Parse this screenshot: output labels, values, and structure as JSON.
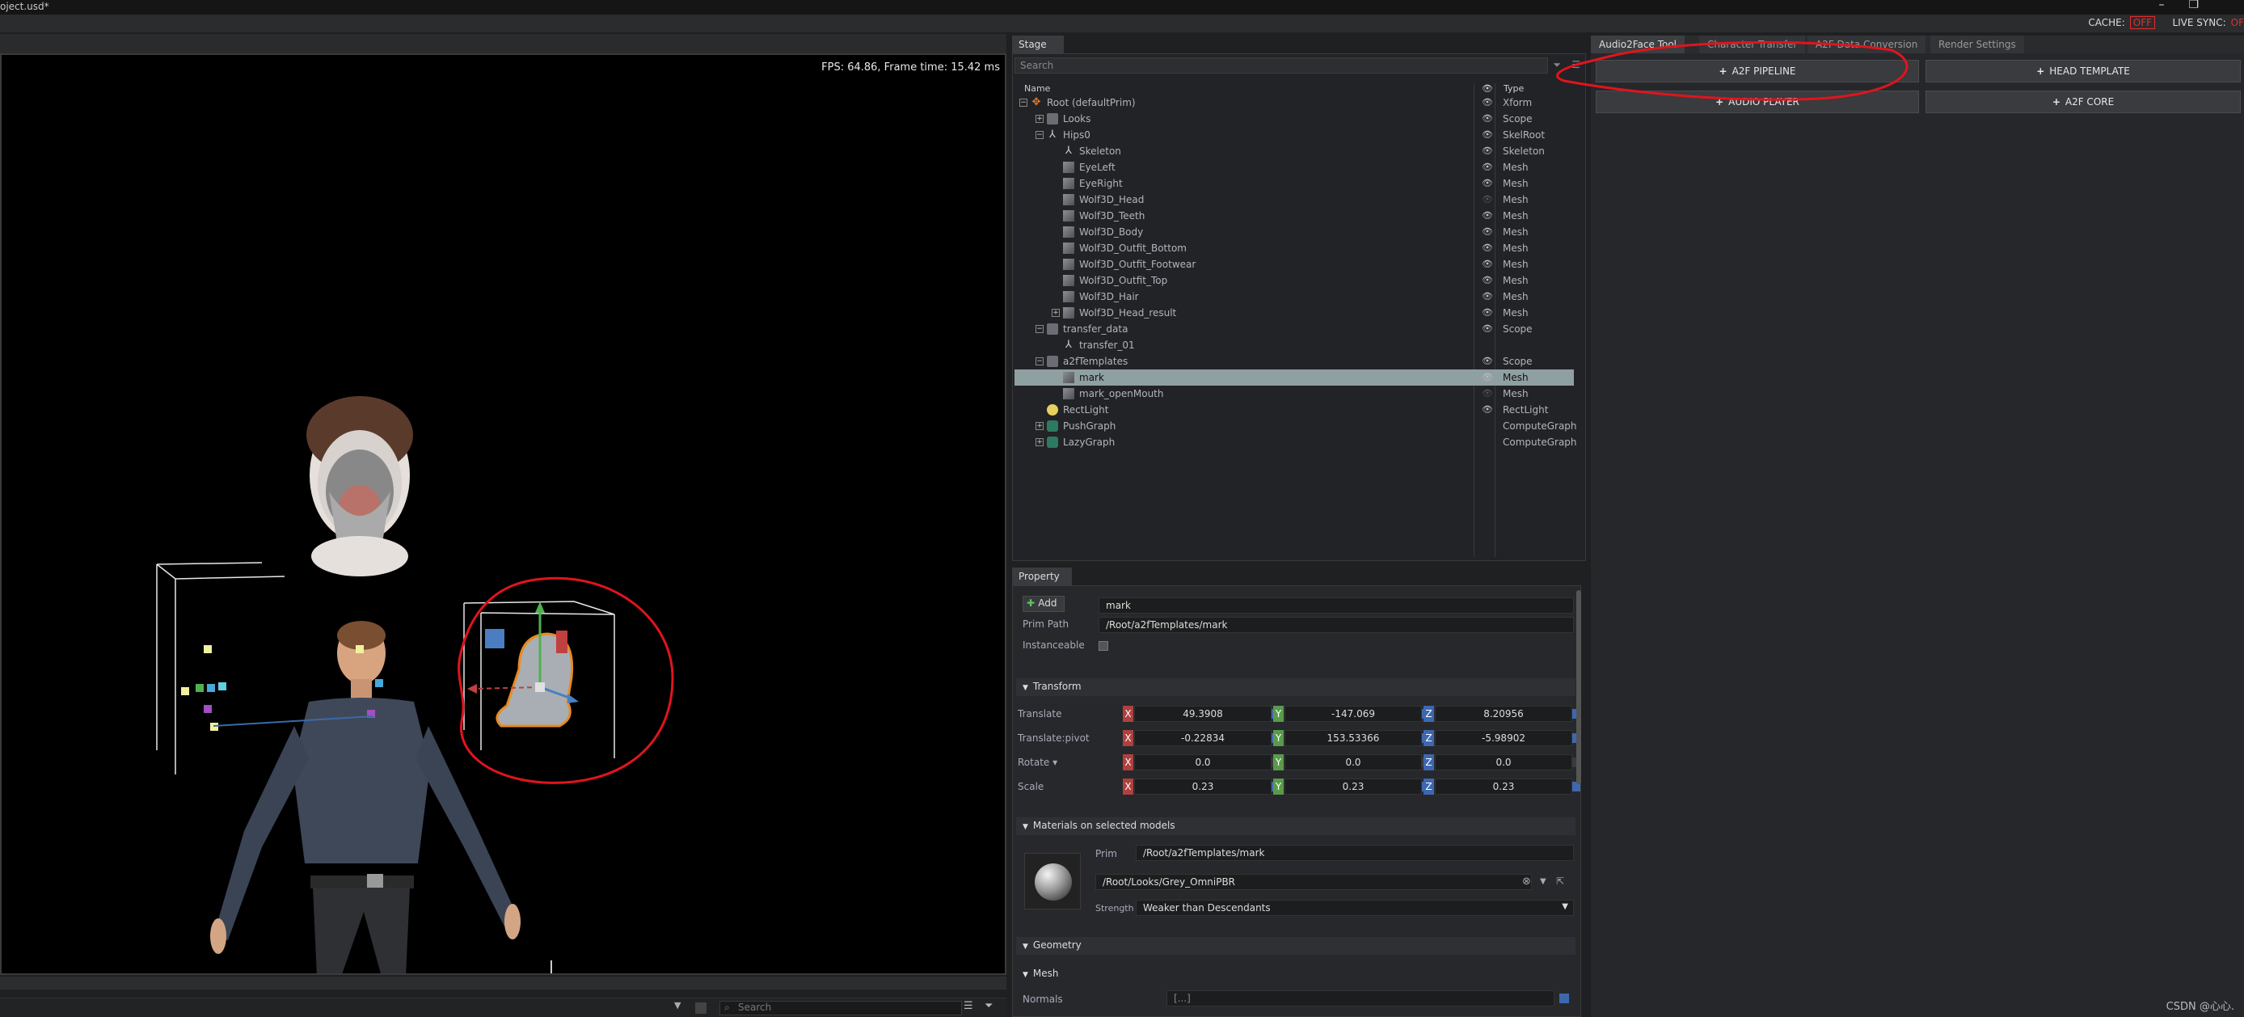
{
  "window": {
    "title": "oject.usd*",
    "cache_label": "CACHE:",
    "cache_state": "OFF",
    "live_sync_label": "LIVE SYNC:",
    "live_sync_state": "OF"
  },
  "viewport": {
    "fps_text": "FPS: 64.86, Frame time: 15.42 ms",
    "search_placeholder": "Search"
  },
  "stage": {
    "tab_label": "Stage",
    "search_placeholder": "Search",
    "col_name": "Name",
    "col_type": "Type",
    "rows": [
      {
        "label": "Root (defaultPrim)",
        "type": "Xform",
        "depth": 0,
        "exp": "−",
        "icon": "xform",
        "eye": true
      },
      {
        "label": "Looks",
        "type": "Scope",
        "depth": 1,
        "exp": "+",
        "icon": "folder",
        "eye": true
      },
      {
        "label": "Hips0",
        "type": "SkelRoot",
        "depth": 1,
        "exp": "−",
        "icon": "skel",
        "eye": true
      },
      {
        "label": "Skeleton",
        "type": "Skeleton",
        "depth": 2,
        "exp": "",
        "icon": "skel",
        "eye": true
      },
      {
        "label": "EyeLeft",
        "type": "Mesh",
        "depth": 2,
        "exp": "",
        "icon": "mesh",
        "eye": true
      },
      {
        "label": "EyeRight",
        "type": "Mesh",
        "depth": 2,
        "exp": "",
        "icon": "mesh",
        "eye": true
      },
      {
        "label": "Wolf3D_Head",
        "type": "Mesh",
        "depth": 2,
        "exp": "",
        "icon": "mesh",
        "eye": false
      },
      {
        "label": "Wolf3D_Teeth",
        "type": "Mesh",
        "depth": 2,
        "exp": "",
        "icon": "mesh",
        "eye": true
      },
      {
        "label": "Wolf3D_Body",
        "type": "Mesh",
        "depth": 2,
        "exp": "",
        "icon": "mesh",
        "eye": true
      },
      {
        "label": "Wolf3D_Outfit_Bottom",
        "type": "Mesh",
        "depth": 2,
        "exp": "",
        "icon": "mesh",
        "eye": true
      },
      {
        "label": "Wolf3D_Outfit_Footwear",
        "type": "Mesh",
        "depth": 2,
        "exp": "",
        "icon": "mesh",
        "eye": true
      },
      {
        "label": "Wolf3D_Outfit_Top",
        "type": "Mesh",
        "depth": 2,
        "exp": "",
        "icon": "mesh",
        "eye": true
      },
      {
        "label": "Wolf3D_Hair",
        "type": "Mesh",
        "depth": 2,
        "exp": "",
        "icon": "mesh",
        "eye": true
      },
      {
        "label": "Wolf3D_Head_result",
        "type": "Mesh",
        "depth": 2,
        "exp": "+",
        "icon": "mesh",
        "eye": true
      },
      {
        "label": "transfer_data",
        "type": "Scope",
        "depth": 1,
        "exp": "−",
        "icon": "folder",
        "eye": true
      },
      {
        "label": "transfer_01",
        "type": "",
        "depth": 2,
        "exp": "",
        "icon": "skel",
        "eye": null
      },
      {
        "label": "a2fTemplates",
        "type": "Scope",
        "depth": 1,
        "exp": "−",
        "icon": "folder",
        "eye": true
      },
      {
        "label": "mark",
        "type": "Mesh",
        "depth": 2,
        "exp": "",
        "icon": "mesh",
        "eye": true,
        "selected": true
      },
      {
        "label": "mark_openMouth",
        "type": "Mesh",
        "depth": 2,
        "exp": "",
        "icon": "mesh",
        "eye": false
      },
      {
        "label": "RectLight",
        "type": "RectLight",
        "depth": 1,
        "exp": "",
        "icon": "light",
        "eye": true
      },
      {
        "label": "PushGraph",
        "type": "ComputeGraph",
        "depth": 1,
        "exp": "+",
        "icon": "graph",
        "eye": null
      },
      {
        "label": "LazyGraph",
        "type": "ComputeGraph",
        "depth": 1,
        "exp": "+",
        "icon": "graph",
        "eye": null
      }
    ]
  },
  "property": {
    "tab_label": "Property",
    "add_label": "Add",
    "name_value": "mark",
    "prim_path_label": "Prim Path",
    "prim_path_value": "/Root/a2fTemplates/mark",
    "instanceable_label": "Instanceable",
    "transform_label": "Transform",
    "translate_label": "Translate",
    "translate": [
      "49.3908",
      "-147.069",
      "8.20956"
    ],
    "pivot_label": "Translate:pivot",
    "pivot": [
      "-0.22834",
      "153.53366",
      "-5.98902"
    ],
    "rotate_label": "Rotate ▾",
    "rotate": [
      "0.0",
      "0.0",
      "0.0"
    ],
    "scale_label": "Scale",
    "scale": [
      "0.23",
      "0.23",
      "0.23"
    ],
    "axis_x": "X",
    "axis_y": "Y",
    "axis_z": "Z",
    "materials_label": "Materials on selected models",
    "prim_label": "Prim",
    "prim_value": "/Root/a2fTemplates/mark",
    "material_value": "/Root/Looks/Grey_OmniPBR",
    "strength_label": "Strength",
    "strength_value": "Weaker than Descendants",
    "geometry_label": "Geometry",
    "mesh_label": "Mesh",
    "normals_label": "Normals",
    "normals_value": "[...]"
  },
  "right_panel": {
    "tabs": [
      "Audio2Face Tool",
      "Character Transfer",
      "A2F Data Conversion",
      "Render Settings"
    ],
    "buttons": {
      "a2f_pipeline": "A2F PIPELINE",
      "head_template": "HEAD TEMPLATE",
      "audio_player": "AUDIO PLAYER",
      "a2f_core": "A2F CORE"
    }
  },
  "watermark": "CSDN @心心.",
  "colors": {
    "annotation_red": "#e0141e",
    "selected_row": "#8fa0a3",
    "axis_x": "#b04040",
    "axis_y": "#5a9a4a",
    "axis_z": "#3d68b0"
  }
}
